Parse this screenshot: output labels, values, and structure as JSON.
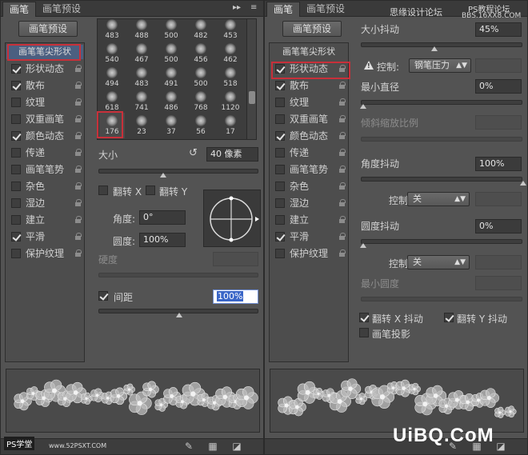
{
  "left": {
    "tabs": [
      "画笔",
      "画笔预设"
    ],
    "preset_button": "画笔预设",
    "tip_header": "画笔笔尖形状",
    "options": [
      {
        "label": "形状动态",
        "checked": true
      },
      {
        "label": "散布",
        "checked": true
      },
      {
        "label": "纹理",
        "checked": false
      },
      {
        "label": "双重画笔",
        "checked": false
      },
      {
        "label": "颜色动态",
        "checked": true
      },
      {
        "label": "传递",
        "checked": false
      },
      {
        "label": "画笔笔势",
        "checked": false
      },
      {
        "label": "杂色",
        "checked": false
      },
      {
        "label": "湿边",
        "checked": false
      },
      {
        "label": "建立",
        "checked": false
      },
      {
        "label": "平滑",
        "checked": true
      },
      {
        "label": "保护纹理",
        "checked": false
      }
    ],
    "brush_sizes": [
      [
        "483",
        "488",
        "500",
        "482",
        "453"
      ],
      [
        "540",
        "467",
        "500",
        "456",
        "462"
      ],
      [
        "494",
        "483",
        "491",
        "500",
        "518"
      ],
      [
        "618",
        "741",
        "486",
        "768",
        "1120"
      ],
      [
        "176",
        "23",
        "37",
        "56",
        "17"
      ]
    ],
    "size_label": "大小",
    "size_value": "40 像素",
    "flip_x": "翻转 X",
    "flip_y": "翻转 Y",
    "angle_label": "角度:",
    "angle_value": "0°",
    "roundness_label": "圆度:",
    "roundness_value": "100%",
    "hardness_label": "硬度",
    "spacing_label": "间距",
    "spacing_value": "100%",
    "size_level": 0.4,
    "spacing_level": 0.5
  },
  "right": {
    "tabs": [
      "画笔",
      "画笔预设"
    ],
    "preset_button": "画笔预设",
    "tip_header": "画笔笔尖形状",
    "options": [
      {
        "label": "形状动态",
        "checked": true
      },
      {
        "label": "散布",
        "checked": true
      },
      {
        "label": "纹理",
        "checked": false
      },
      {
        "label": "双重画笔",
        "checked": false
      },
      {
        "label": "颜色动态",
        "checked": true
      },
      {
        "label": "传递",
        "checked": false
      },
      {
        "label": "画笔笔势",
        "checked": false
      },
      {
        "label": "杂色",
        "checked": false
      },
      {
        "label": "湿边",
        "checked": false
      },
      {
        "label": "建立",
        "checked": false
      },
      {
        "label": "平滑",
        "checked": true
      },
      {
        "label": "保护纹理",
        "checked": false
      }
    ],
    "size_jitter_label": "大小抖动",
    "size_jitter_value": "45%",
    "control_label": "控制:",
    "control_pen": "钢笔压力",
    "min_diameter_label": "最小直径",
    "min_diameter_value": "0%",
    "tilt_scale_label": "倾斜缩放比例",
    "angle_jitter_label": "角度抖动",
    "angle_jitter_value": "100%",
    "control_off": "关",
    "roundness_jitter_label": "圆度抖动",
    "roundness_jitter_value": "0%",
    "min_roundness_label": "最小圆度",
    "flip_x_jitter": "翻转 X 抖动",
    "flip_y_jitter": "翻转 Y 抖动",
    "brush_projection": "画笔投影",
    "size_jitter_level": 0.45,
    "angle_jitter_level": 1.0
  },
  "watermarks": {
    "top_right_1": "思缘设计论坛",
    "top_right_2": "PS教程论坛",
    "top_right_3": "BBS.16XX8.COM",
    "logo": "UiBQ.CoM",
    "bottom_left": "PS学堂",
    "bottom_left_url": "www.52PSXT.COM"
  }
}
